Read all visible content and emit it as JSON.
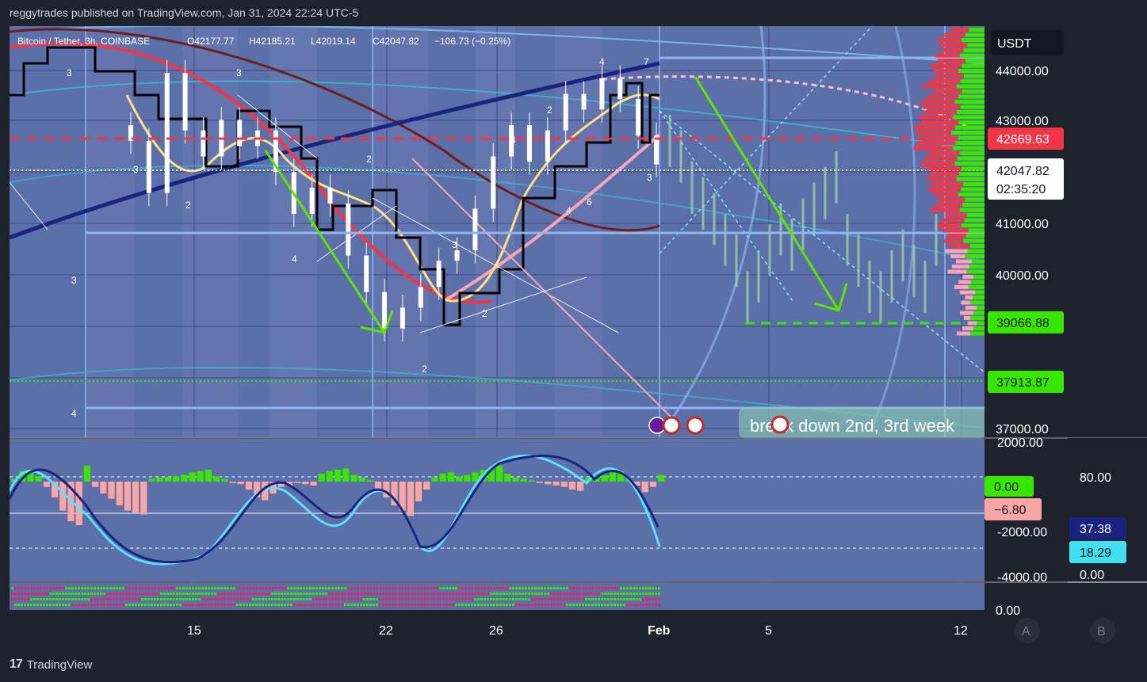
{
  "header": {
    "text": "reggytrades published on TradingView.com, Jan 31, 2024 22:24 UTC-5"
  },
  "footer": {
    "brand": "TradingView",
    "logo": "17"
  },
  "chart_data": {
    "type": "candlestick",
    "symbol_line": "Bitcoin / Tether, 3h, COINBASE",
    "ohlc": {
      "open": "O42177.77",
      "high": "H42185.21",
      "low": "L42019.14",
      "close": "C42047.82",
      "change": "−106.73 (−0.25%)"
    },
    "currency": "USDT",
    "x_ticks": [
      "15",
      "22",
      "26",
      "Feb",
      "5",
      "12"
    ],
    "price_ticks": [
      "44000.00",
      "43000.00",
      "41000.00",
      "40000.00",
      "37000.00"
    ],
    "price_range": [
      36800,
      44700
    ],
    "tags": {
      "resistance": "42669.63",
      "last": "42047.82",
      "countdown": "02:35:20",
      "support": "39066.88",
      "low_line": "37913.87"
    },
    "annotation": "break down 2nd, 3rd week",
    "wave_labels": [
      "3",
      "3",
      "2",
      "3",
      "4",
      "3",
      "2",
      "4",
      "3",
      "2",
      "2",
      "4",
      "2",
      "4",
      "6",
      "4",
      "7",
      "3"
    ],
    "candles": [
      42500,
      41500,
      43800,
      42700,
      42200,
      42900,
      42400,
      42700,
      41900,
      41100,
      41600,
      41300,
      40300,
      39600,
      38900,
      39300,
      39700,
      40200,
      40400,
      41200,
      42200,
      42800,
      42100,
      42700,
      43400,
      43100,
      43700,
      43300,
      42600,
      42047
    ],
    "indicator": {
      "ticks": [
        "2000.00",
        "-2000.00",
        "-4000.00"
      ],
      "tags": {
        "zero": "0.00",
        "hist": "−6.80"
      },
      "range": [
        -5200,
        2600
      ]
    },
    "oscillator": {
      "ticks": [
        "80.00",
        "0.00"
      ],
      "tags": {
        "a": "37.38",
        "b": "18.29"
      },
      "bottom_label": "0.00"
    },
    "buttons": [
      "A",
      "B"
    ]
  },
  "colors": {
    "background": "#5b6fa8",
    "panel": "#1e222d",
    "green": "#39e600",
    "red": "#f23645",
    "pink": "#f8a5b8",
    "yellow": "#ffe082",
    "navy": "#1a237e",
    "cyan": "#40e0f0"
  }
}
